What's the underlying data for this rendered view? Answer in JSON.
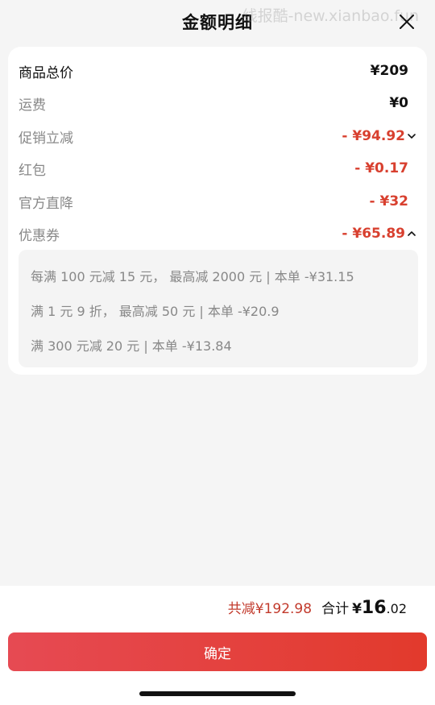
{
  "header": {
    "title": "金额明细",
    "watermark": "线报酷-new.xianbao.fun"
  },
  "breakdown": {
    "rows": [
      {
        "label": "商品总价",
        "value": "¥209"
      },
      {
        "label": "运费",
        "value": "¥0"
      },
      {
        "label": "促销立减",
        "value": "- ¥94.92"
      },
      {
        "label": "红包",
        "value": "- ¥0.17"
      },
      {
        "label": "官方直降",
        "value": "- ¥32"
      },
      {
        "label": "优惠券",
        "value": "- ¥65.89"
      }
    ],
    "coupon_details": [
      "每满 100 元减 15 元， 最高减 2000 元 | 本单 -¥31.15",
      "满 1 元 9 折， 最高减 50 元 | 本单 -¥20.9",
      "满 300 元减 20 元 | 本单 -¥13.84"
    ]
  },
  "footer": {
    "saved_label": "共减",
    "saved_value": "¥192.98",
    "total_label": "合计",
    "total_currency": "¥",
    "total_int": "16",
    "total_dec": ".02",
    "confirm_label": "确定"
  },
  "colors": {
    "accent_red": "#d8402f",
    "button_gradient_start": "#e64a53",
    "button_gradient_end": "#e23a2c"
  }
}
